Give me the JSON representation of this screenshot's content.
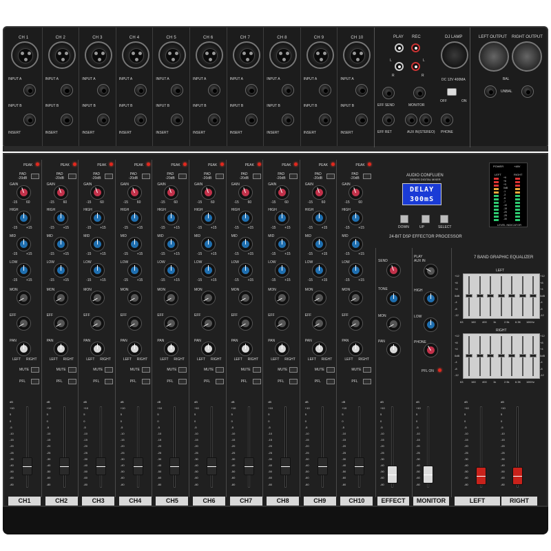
{
  "channels": [
    "CH 1",
    "CH 2",
    "CH 3",
    "CH 4",
    "CH 5",
    "CH 6",
    "CH 7",
    "CH 8",
    "CH 9",
    "CH 10"
  ],
  "channel_strip_labels": [
    "CH1",
    "CH2",
    "CH3",
    "CH4",
    "CH5",
    "CH6",
    "CH7",
    "CH8",
    "CH9",
    "CH10"
  ],
  "inputs": {
    "input_a": "INPUT A",
    "input_b": "INPUT B",
    "insert": "INSERT"
  },
  "play_rec": {
    "play": "PLAY",
    "rec": "REC",
    "l": "L",
    "r": "R"
  },
  "dj_lamp": {
    "label": "DJ LAMP",
    "spec": "DC 12V  400MA",
    "off": "OFF",
    "on": "ON"
  },
  "rear_labels": {
    "eff_send": "EFF SEND",
    "monitor": "MONITOR",
    "eff_ret": "EFF RET",
    "aux": "AUX IN(STEREO)",
    "phone": "PHONE"
  },
  "outputs": {
    "left": "LEFT OUTPUT",
    "right": "RIGHT OUTPUT",
    "bal": "BAL",
    "unbal": "UNBAL"
  },
  "strip_controls": {
    "peak": "PEAK",
    "pad": "PAD",
    "pad_db": "-20dB",
    "gain": "GAIN",
    "high": "HIGH",
    "mid": "MID",
    "low": "LOW",
    "mon": "MON",
    "eff": "EFF",
    "pan": "PAN",
    "mute": "MUTE",
    "pfl": "PFL",
    "left": "LEFT",
    "right": "RIGHT",
    "g_lo": "-15",
    "g_hi": "60",
    "eq_lo": "-15",
    "eq_hi": "+15"
  },
  "dsp": {
    "brand": "AUDIO CONFLUEN",
    "series": "SERIES DIGITAL MIXER",
    "lcd_line1": "DELAY",
    "lcd_line2": "300mS",
    "down": "DOWN",
    "up": "UP",
    "select": "SELECT",
    "processor": "24-BIT DSP  EFFECTOR  PROCESSOR"
  },
  "meter": {
    "power": "POWER",
    "p48": "+48V",
    "left": "LEFT",
    "right": "RIGHT",
    "title": "LEVEL INDICATOR",
    "scale": [
      "+9",
      "+6",
      "+3",
      "0dB",
      "-1",
      "-3",
      "-5",
      "-7",
      "-10",
      "-15",
      "-20",
      "-25",
      "-30"
    ]
  },
  "effect_section": {
    "send": "SEND",
    "tone": "TONE",
    "mon": "MON",
    "pan": "PAN"
  },
  "monitor_section": {
    "play_aux": "PLAY",
    "aux_in": "AUX IN",
    "high": "HIGH",
    "low": "LOW",
    "phone": "PHONE",
    "pfl_on": "PFL ON"
  },
  "geq": {
    "title": "7 BAND GRAPHIC EQUALIZER",
    "left": "LEFT",
    "right": "RIGHT",
    "bands": [
      "63",
      "160",
      "400",
      "1k",
      "2.5k",
      "6.3K",
      "16KHz"
    ],
    "scale": [
      "+12",
      "+8",
      "+4",
      "0dB",
      "-4",
      "-8",
      "-12"
    ]
  },
  "fader_scale": [
    "dB",
    "+10",
    "5",
    "0",
    "-5",
    "-10",
    "-15",
    "-20",
    "-25",
    "-30",
    "-40",
    "-50",
    "-60",
    "-80"
  ],
  "bottom_labels": {
    "effect": "EFFECT",
    "monitor": "MONITOR",
    "left": "LEFT",
    "right": "RIGHT"
  },
  "colors": {
    "panel": "#1e1e1e",
    "gain_knob": "#c2314a",
    "eq_knob": "#1f6fb0",
    "mon_knob": "#555555",
    "pan_knob": "#d8d8d8",
    "master_fader": "#c9221b",
    "fader_cap": "#2a2a2a",
    "effect_fader": "#dddddd"
  }
}
